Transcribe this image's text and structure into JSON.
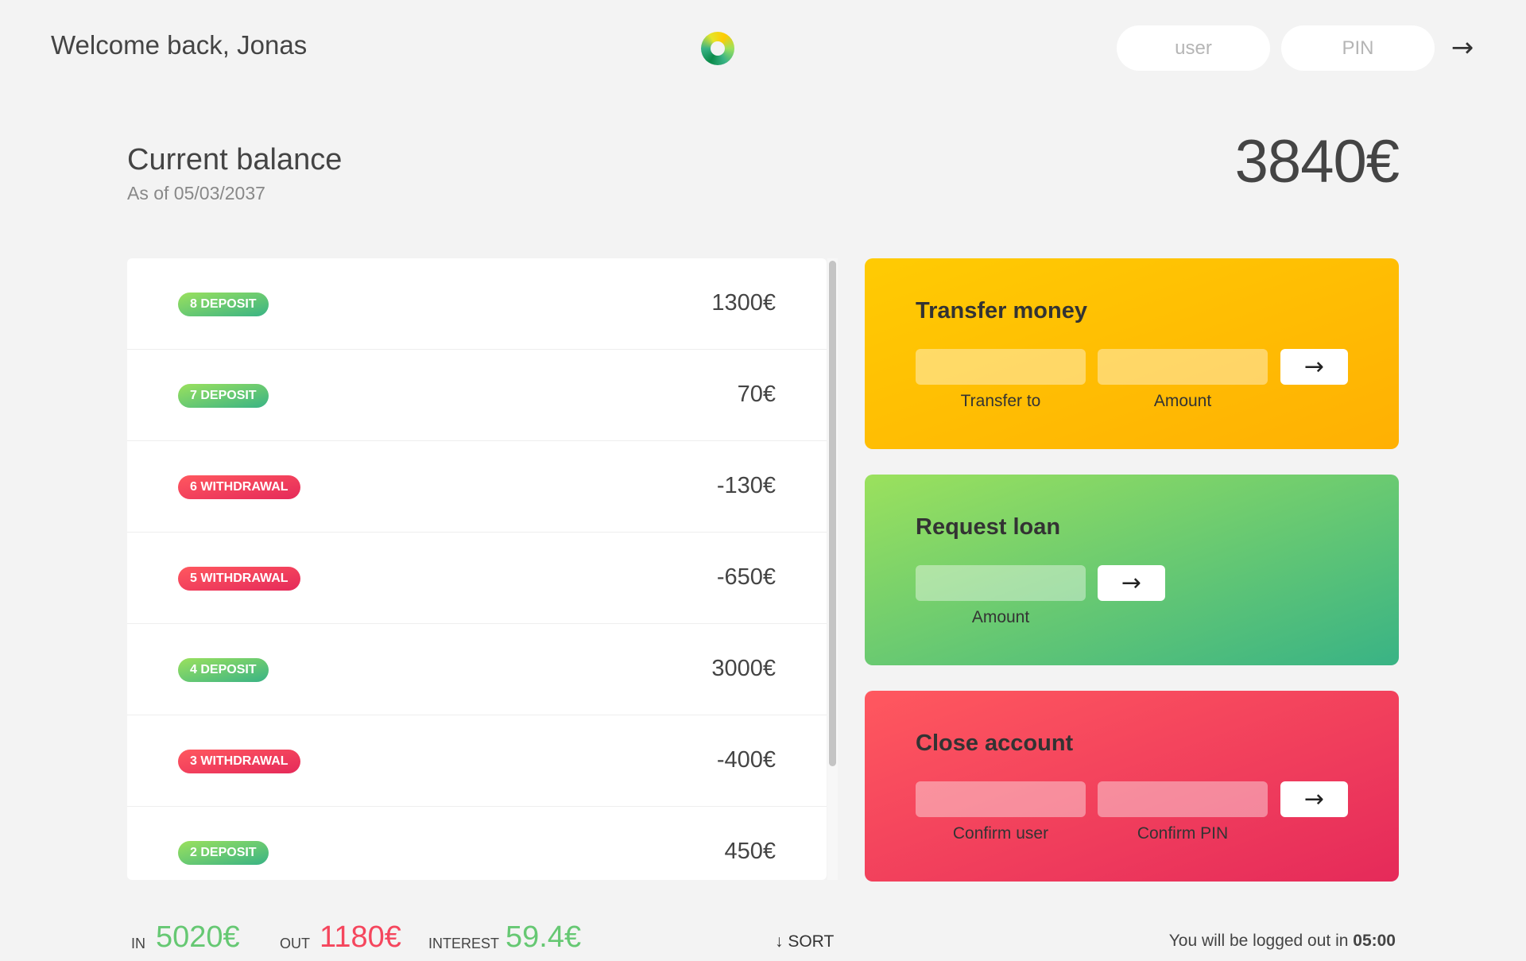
{
  "nav": {
    "welcome": "Welcome back, Jonas",
    "user_placeholder": "user",
    "pin_placeholder": "PIN",
    "login_icon": "arrow-right-icon"
  },
  "balance": {
    "label": "Current balance",
    "date": "As of 05/03/2037",
    "value": "3840€"
  },
  "movements": [
    {
      "type": "deposit",
      "label": "8 DEPOSIT",
      "value": "1300€"
    },
    {
      "type": "deposit",
      "label": "7 DEPOSIT",
      "value": "70€"
    },
    {
      "type": "withdrawal",
      "label": "6 WITHDRAWAL",
      "value": "-130€"
    },
    {
      "type": "withdrawal",
      "label": "5 WITHDRAWAL",
      "value": "-650€"
    },
    {
      "type": "deposit",
      "label": "4 DEPOSIT",
      "value": "3000€"
    },
    {
      "type": "withdrawal",
      "label": "3 WITHDRAWAL",
      "value": "-400€"
    },
    {
      "type": "deposit",
      "label": "2 DEPOSIT",
      "value": "450€"
    }
  ],
  "operations": {
    "transfer": {
      "title": "Transfer money",
      "label_to": "Transfer to",
      "label_amount": "Amount",
      "button": "→"
    },
    "loan": {
      "title": "Request loan",
      "label_amount": "Amount",
      "button": "→"
    },
    "close": {
      "title": "Close account",
      "label_user": "Confirm user",
      "label_pin": "Confirm PIN",
      "button": "→"
    }
  },
  "summary": {
    "in_label": "In",
    "in_value": "5020€",
    "out_label": "Out",
    "out_value": "1180€",
    "interest_label": "Interest",
    "interest_value": "59.4€",
    "sort_label": "↓ SORT"
  },
  "logout": {
    "text": "You will be logged out in",
    "timer": "05:00"
  },
  "colors": {
    "background": "#f3f3f3",
    "deposit": "#39b385",
    "withdrawal": "#e52a5a",
    "transfer": "#ffcb03",
    "positive": "#66c873",
    "negative": "#f5465d"
  }
}
